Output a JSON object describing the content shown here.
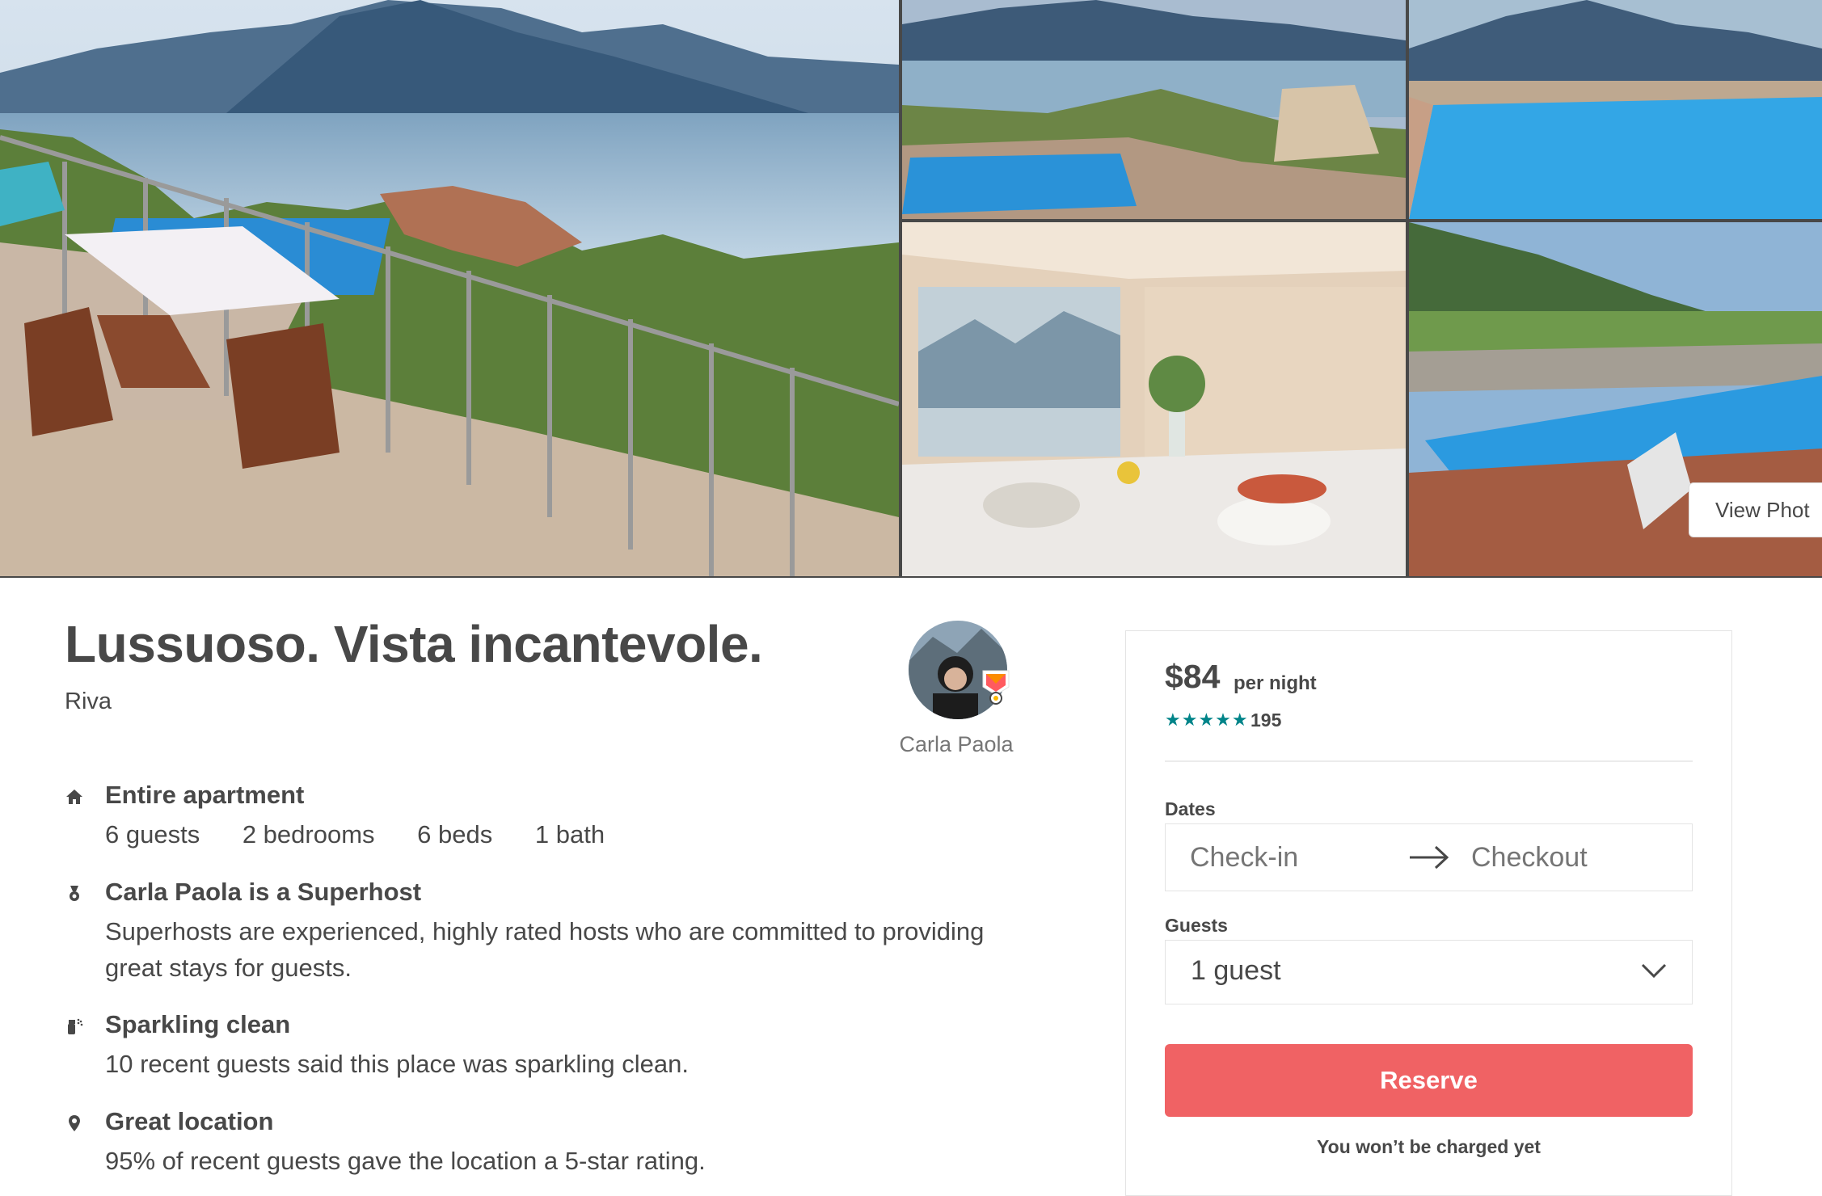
{
  "gallery": {
    "photos": [
      "terrace-lake-view",
      "lake-pool-view",
      "pool-closeup",
      "dining-room",
      "pool-mountains"
    ],
    "view_photos_label": "View Phot"
  },
  "listing": {
    "title": "Lussuoso. Vista incantevole.",
    "location": "Riva"
  },
  "host": {
    "name": "Carla Paola"
  },
  "features": [
    {
      "icon": "home-icon",
      "title": "Entire apartment",
      "meta": [
        "6 guests",
        "2 bedrooms",
        "6 beds",
        "1 bath"
      ]
    },
    {
      "icon": "medal-icon",
      "title": "Carla Paola is a Superhost",
      "description": "Superhosts are experienced, highly rated hosts who are committed to providing great stays for guests."
    },
    {
      "icon": "spray-bottle-icon",
      "title": "Sparkling clean",
      "description": "10 recent guests said this place was sparkling clean."
    },
    {
      "icon": "location-pin-icon",
      "title": "Great location",
      "description": "95% of recent guests gave the location a 5-star rating."
    }
  ],
  "booking": {
    "price": "$84",
    "per_night": "per night",
    "stars": "★★★★★",
    "rating_value": 5,
    "review_count": "195",
    "dates_label": "Dates",
    "checkin_placeholder": "Check-in",
    "checkout_placeholder": "Checkout",
    "guests_label": "Guests",
    "guests_value": "1 guest",
    "reserve_label": "Reserve",
    "no_charge_note": "You won’t be charged yet"
  },
  "colors": {
    "accent": "#f06264",
    "star": "#008489",
    "text": "#484848",
    "muted": "#767676"
  }
}
